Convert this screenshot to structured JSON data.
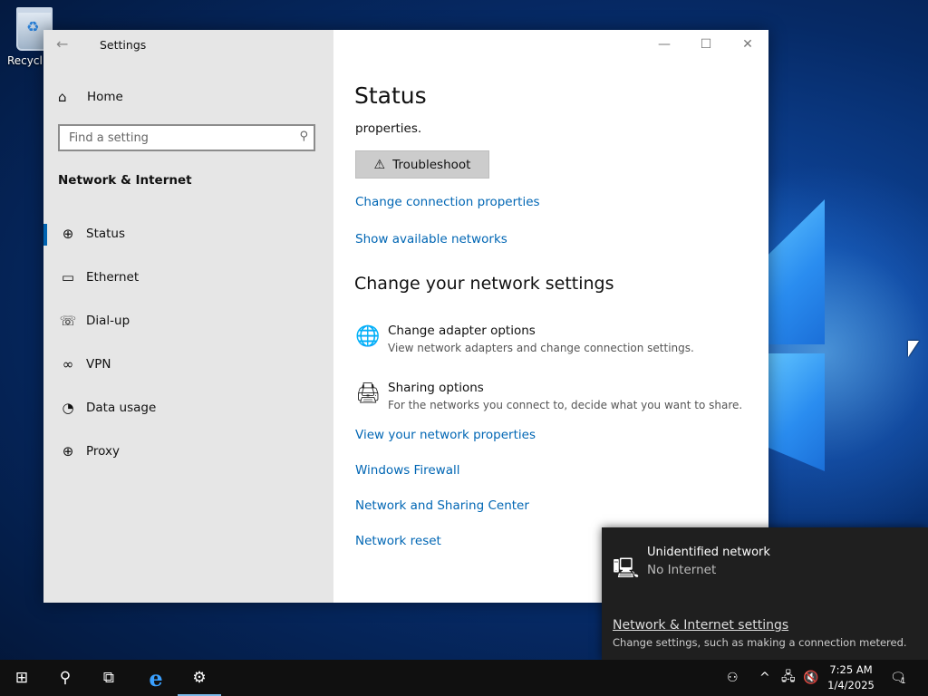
{
  "desktop": {
    "recycle_label": "Recycl"
  },
  "window": {
    "title": "Settings",
    "back_glyph": "←",
    "minimize": "—",
    "maximize": "☐",
    "close": "✕"
  },
  "sidebar": {
    "home_label": "Home",
    "search_placeholder": "Find a setting",
    "section_title": "Network & Internet",
    "items": [
      {
        "label": "Status",
        "icon": "globe-icon",
        "active": true
      },
      {
        "label": "Ethernet",
        "icon": "ethernet-icon"
      },
      {
        "label": "Dial-up",
        "icon": "dialup-icon"
      },
      {
        "label": "VPN",
        "icon": "vpn-icon"
      },
      {
        "label": "Data usage",
        "icon": "data-usage-icon"
      },
      {
        "label": "Proxy",
        "icon": "proxy-globe-icon"
      }
    ]
  },
  "main": {
    "heading": "Status",
    "partial_text": "properties.",
    "troubleshoot_label": "Troubleshoot",
    "links_top": [
      "Change connection properties",
      "Show available networks"
    ],
    "section_heading": "Change your network settings",
    "options": [
      {
        "title": "Change adapter options",
        "desc": "View network adapters and change connection settings.",
        "icon": "adapter-globe-icon"
      },
      {
        "title": "Sharing options",
        "desc": "For the networks you connect to, decide what you want to share.",
        "icon": "sharing-icon"
      }
    ],
    "links_bottom": [
      "View your network properties",
      "Windows Firewall",
      "Network and Sharing Center",
      "Network reset"
    ]
  },
  "flyout": {
    "network_name": "Unidentified network",
    "status": "No Internet",
    "settings_link": "Network & Internet settings",
    "settings_desc": "Change settings, such as making a connection metered."
  },
  "taskbar": {
    "time": "7:25 AM",
    "date": "1/4/2025",
    "notification_count": "1"
  },
  "colors": {
    "accent": "#0063b1",
    "link": "#0066b4",
    "taskbar": "#101010"
  }
}
